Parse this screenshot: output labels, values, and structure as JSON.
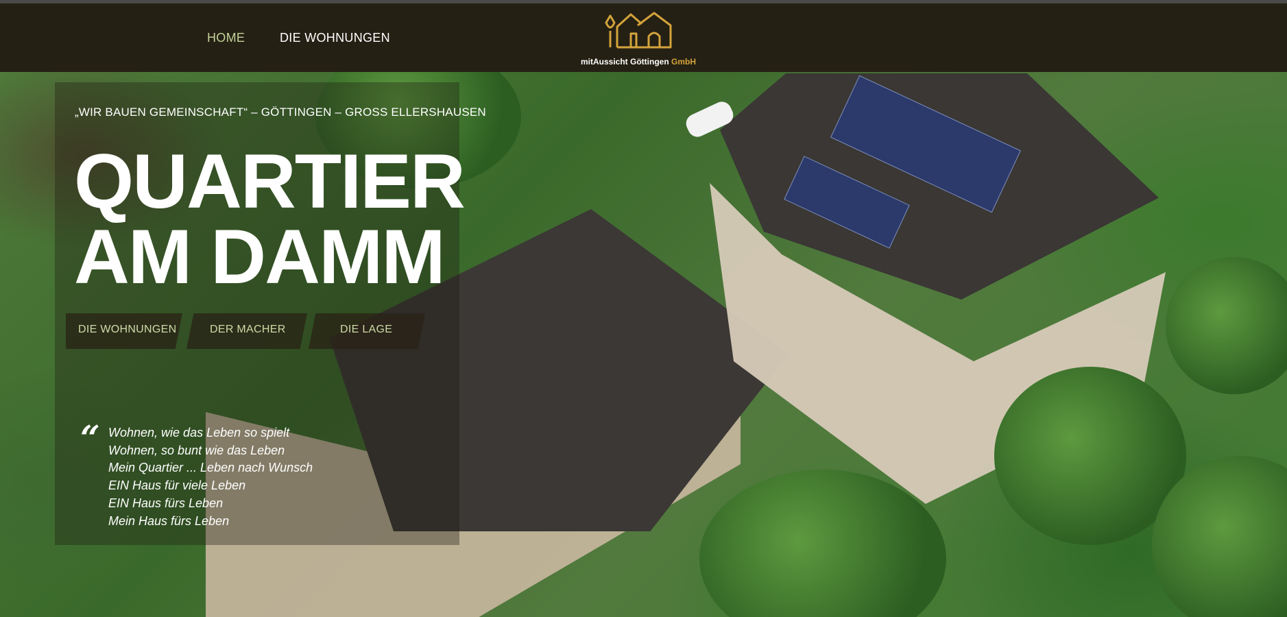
{
  "nav": {
    "items": [
      {
        "label": "HOME",
        "active": true
      },
      {
        "label": "DIE WOHNUNGEN",
        "active": false
      }
    ]
  },
  "logo": {
    "icon": "houses-tree-logo-icon",
    "name": "mitAussicht Göttingen",
    "suffix": "GmbH"
  },
  "hero": {
    "tagline": "„WIR BAUEN GEMEINSCHAFT“ – GÖTTINGEN – GROSS ELLERSHAUSEN",
    "title_line1": "QUARTIER",
    "title_line2": "AM DAMM",
    "subnav": [
      "DIE WOHNUNGEN",
      "DER MACHER",
      "DIE LAGE"
    ],
    "quote_icon": "quote-mark-icon",
    "quote_lines": [
      "Wohnen, wie das Leben so spielt",
      "Wohnen, so bunt wie das Leben",
      "Mein Quartier ... Leben nach Wunsch",
      "EIN Haus für viele Leben",
      "EIN Haus fürs Leben",
      "Mein Haus fürs Leben"
    ]
  },
  "colors": {
    "navbar": "#252014",
    "nav_active": "#c4d49a",
    "logo_accent": "#d4a43b",
    "subnav_text": "#cfdba8"
  }
}
